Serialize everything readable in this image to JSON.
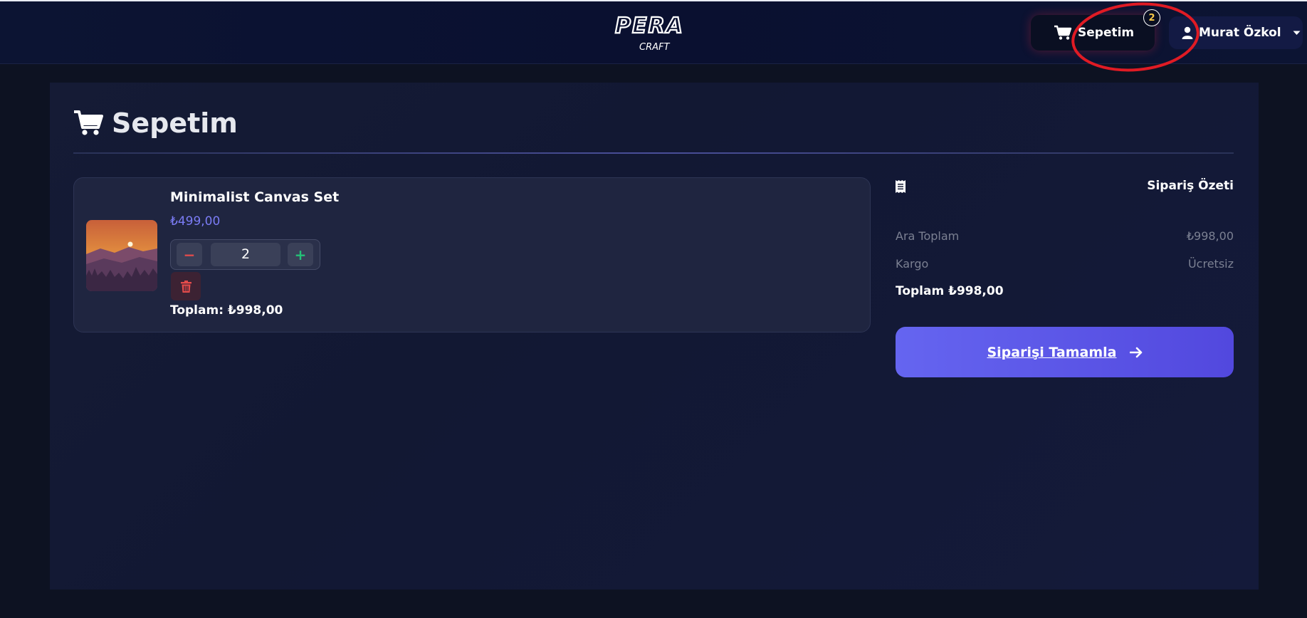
{
  "header": {
    "logo": {
      "primary": "PERA",
      "secondary": "CRAFT"
    },
    "cart": {
      "label": "Sepetim",
      "count": "2",
      "icon": "cart-icon"
    },
    "user": {
      "name": "Murat Özkol",
      "icon": "user-icon"
    }
  },
  "page": {
    "title": "Sepetim",
    "icon": "cart-icon"
  },
  "cart_items": [
    {
      "name": "Minimalist Canvas Set",
      "unit_price": "₺499,00",
      "quantity": "2",
      "total": "Toplam: ₺998,00"
    }
  ],
  "summary": {
    "title": "Sipariş Özeti",
    "subtotal_label": "Ara Toplam",
    "subtotal_value": "₺998,00",
    "shipping_label": "Kargo",
    "shipping_value": "Ücretsiz",
    "total": "Toplam ₺998,00",
    "checkout_label": "Siparişi Tamamla"
  },
  "colors": {
    "background": "#0d1222",
    "accent": "#6565f0",
    "price": "#7b7cf5",
    "badge_text": "#f7c948",
    "annotation": "#e01b24"
  }
}
